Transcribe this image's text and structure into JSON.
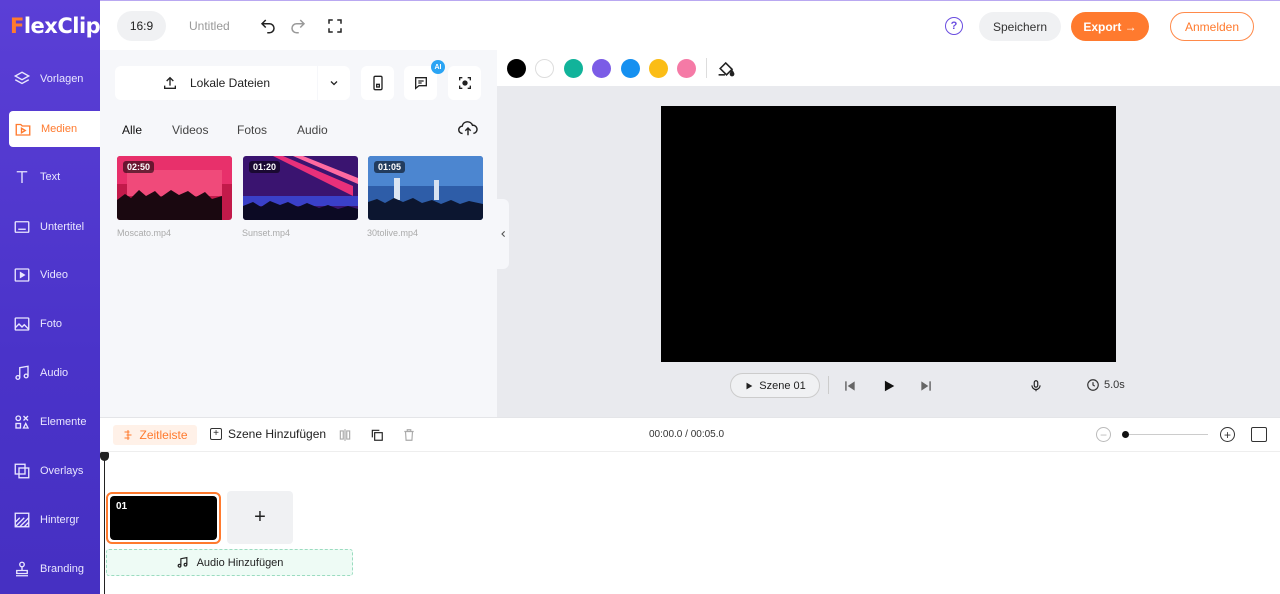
{
  "sidebar": {
    "logo_main": "lexClip",
    "logo_letter": "F",
    "items": [
      {
        "label": "Vorlagen",
        "icon": "layers-icon"
      },
      {
        "label": "Medien",
        "icon": "media-folder-icon"
      },
      {
        "label": "Text",
        "icon": "text-icon"
      },
      {
        "label": "Untertitel",
        "icon": "subtitle-icon"
      },
      {
        "label": "Video",
        "icon": "video-icon"
      },
      {
        "label": "Foto",
        "icon": "photo-icon"
      },
      {
        "label": "Audio",
        "icon": "music-note-icon"
      },
      {
        "label": "Elemente",
        "icon": "elements-icon"
      },
      {
        "label": "Overlays",
        "icon": "overlay-icon"
      },
      {
        "label": "Hintergr",
        "icon": "background-icon"
      },
      {
        "label": "Branding",
        "icon": "stamp-icon"
      }
    ],
    "active_index": 1
  },
  "header": {
    "ratio": "16:9",
    "title": "Untitled",
    "help": "?",
    "save": "Speichern",
    "export": "Export →",
    "login": "Anmelden"
  },
  "media": {
    "upload_label": "Lokale Dateien",
    "ai_badge": "AI",
    "tabs": [
      "Alle",
      "Videos",
      "Fotos",
      "Audio"
    ],
    "active_tab": 0,
    "items": [
      {
        "duration": "02:50",
        "name": "Moscato.mp4"
      },
      {
        "duration": "01:20",
        "name": "Sunset.mp4"
      },
      {
        "duration": "01:05",
        "name": "30tolive.mp4"
      }
    ]
  },
  "stage": {
    "colors": [
      "#000000",
      "#ffffff",
      "#11b39a",
      "#7b5ce6",
      "#1590f0",
      "#fbbd16",
      "#f57aa6"
    ],
    "scene_label": "Szene 01",
    "duration": "5.0s"
  },
  "timeline": {
    "tab_label": "Zeitleiste",
    "add_scene": "Szene Hinzufügen",
    "time_readout": "00:00.0 / 00:05.0",
    "clip_number": "01",
    "add_clip": "+",
    "audio_label": "Audio Hinzufügen",
    "zoom_minus": "−",
    "zoom_plus": "+"
  }
}
